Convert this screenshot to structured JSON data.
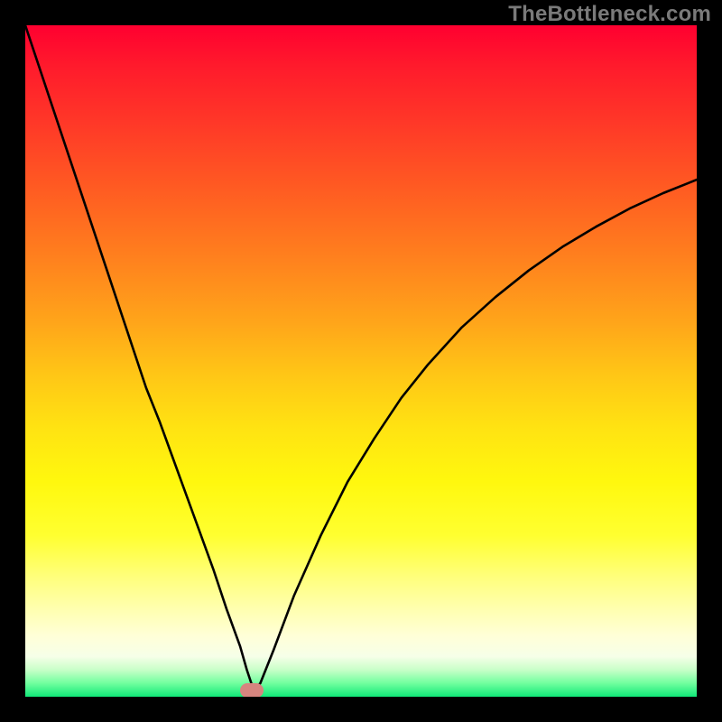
{
  "watermark": "TheBottleneck.com",
  "chart_data": {
    "type": "line",
    "title": "",
    "xlabel": "",
    "ylabel": "",
    "xlim": [
      0,
      100
    ],
    "ylim": [
      0,
      100
    ],
    "grid": false,
    "background": "vertical-gradient red-to-green",
    "series": [
      {
        "name": "bottleneck-curve",
        "color": "#000000",
        "x": [
          0,
          2,
          4,
          6,
          8,
          10,
          12,
          14,
          16,
          18,
          20,
          22,
          24,
          26,
          28,
          30,
          32,
          33,
          34,
          35,
          37,
          40,
          44,
          48,
          52,
          56,
          60,
          65,
          70,
          75,
          80,
          85,
          90,
          95,
          100
        ],
        "y": [
          100,
          94,
          88,
          82,
          76,
          70,
          64,
          58,
          52,
          46,
          41,
          35.5,
          30,
          24.5,
          19,
          13,
          7.5,
          4,
          1,
          2,
          7,
          15,
          24,
          32,
          38.5,
          44.5,
          49.5,
          55,
          59.5,
          63.5,
          67,
          70,
          72.7,
          75,
          77
        ]
      }
    ],
    "marker": {
      "name": "minimum-point",
      "x": 33.7,
      "y": 0.9,
      "color": "#d6857f"
    }
  }
}
